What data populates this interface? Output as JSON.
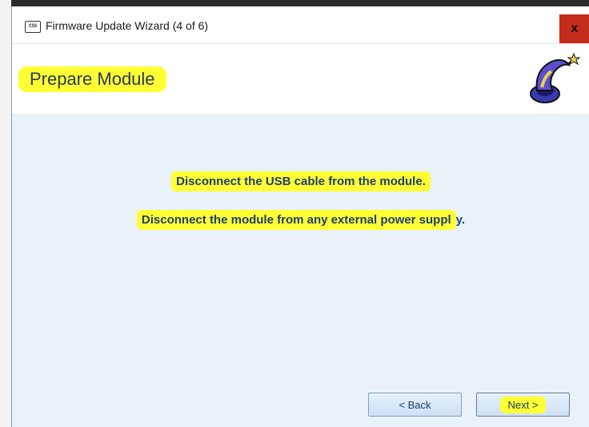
{
  "window": {
    "app_icon_text": "CSS",
    "title": "Firmware Update Wizard (4 of 6)",
    "close_label": "x"
  },
  "header": {
    "title": "Prepare Module",
    "icon": "wizard-hat-icon"
  },
  "content": {
    "message_1": "Disconnect the USB cable from the module.",
    "message_2_highlighted": "Disconnect the module from any external power suppl",
    "message_2_rest": "y."
  },
  "buttons": {
    "back_label": "< Back",
    "next_label": "Next >"
  },
  "colors": {
    "highlight": "#ffff33",
    "content_bg": "#eaf2f9",
    "text": "#1f3d73",
    "close_bg": "#c42b1c"
  }
}
